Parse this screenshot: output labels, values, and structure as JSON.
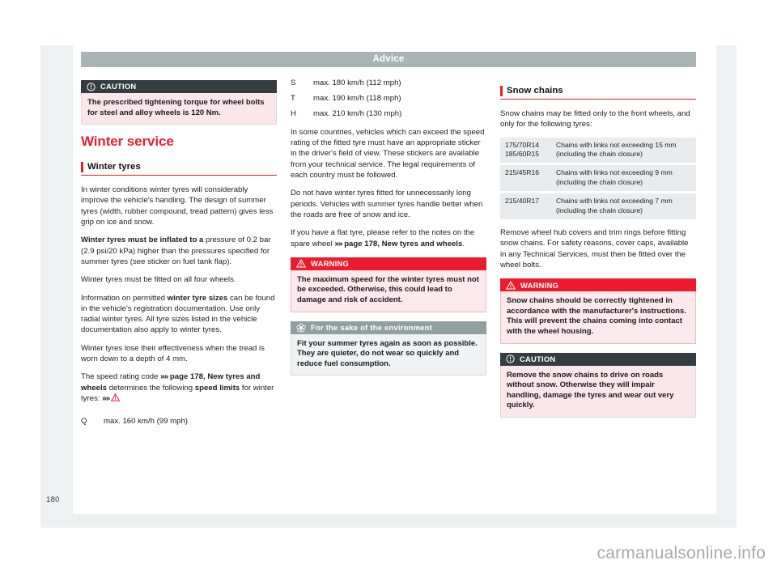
{
  "document": {
    "running_header": "Advice",
    "page_number": "180",
    "watermark": "carmanualsonline.info"
  },
  "colors": {
    "accent_red": "#ec1c2e",
    "warning_red": "#ed1b2e",
    "caution_dark": "#343d40",
    "env_gray": "#90a09e",
    "header_gray": "#a8b5b4",
    "table_row": "#e9ecee"
  },
  "column1": {
    "caution_box": {
      "icon": "exclamation-circle-icon",
      "title": "CAUTION",
      "text": "The prescribed tightening torque for wheel bolts for steel and alloy wheels is 120 Nm."
    },
    "section_title": "Winter service",
    "subsection_title": "Winter tyres",
    "paragraphs": [
      "In winter conditions winter tyres will considerably improve the vehicle's handling. The design of summer tyres (width, rubber compound, tread pattern) gives less grip on ice and snow.",
      "Winter tyres must be fitted on all four wheels.",
      "Winter tyres lose their effectiveness when the tread is worn down to a depth of 4 mm."
    ],
    "pressure_paragraph": {
      "bold_lead": "Winter tyres must be inflated to a",
      "rest": " pressure of 0.2 bar (2.9 psi/20 kPa) higher than the pressures specified for summer tyres (see sticker on fuel tank flap)."
    },
    "sizes_paragraph": {
      "part1": "Information on permitted ",
      "bold": "winter tyre sizes",
      "part2": " can be found in the vehicle's registration documentation. Use only radial winter tyres. All tyre sizes listed in the vehicle documentation also apply to winter tyres."
    },
    "speed_code_paragraph": {
      "part1": "The speed rating code ",
      "arrow": "»»",
      "ref": " page 178, New tyres and wheels",
      "part2": " determines the following ",
      "bold": "speed limits",
      "part3": " for winter tyres: ",
      "arrow2": "»»",
      "triangle_icon": "warning-triangle-icon"
    },
    "speed_rating_first": {
      "code": "Q",
      "value": "max. 160 km/h (99 mph)"
    }
  },
  "column2": {
    "speed_ratings": [
      {
        "code": "S",
        "value": "max. 180 km/h (112 mph)"
      },
      {
        "code": "T",
        "value": "max. 190 km/h (118 mph)"
      },
      {
        "code": "H",
        "value": "max. 210 km/h (130 mph)"
      }
    ],
    "paragraphs": [
      "In some countries, vehicles which can exceed the speed rating of the fitted tyre must have an appropriate sticker in the driver's field of view. These stickers are available from your technical service. The legal requirements of each country must be followed.",
      "Do not have winter tyres fitted for unnecessarily long periods. Vehicles with summer tyres handle better when the roads are free of snow and ice."
    ],
    "flat_tyre_paragraph": {
      "part1": "If you have a flat tyre, please refer to the notes on the spare wheel ",
      "arrow": "»»",
      "ref": " page 178, New tyres and wheels",
      "part2": "."
    },
    "warning_box": {
      "icon": "warning-triangle-icon",
      "title": "WARNING",
      "text": "The maximum speed for the winter tyres must not be exceeded. Otherwise, this could lead to damage and risk of accident."
    },
    "environment_box": {
      "icon": "environment-flower-icon",
      "title": "For the sake of the environment",
      "text": "Fit your summer tyres again as soon as possible. They are quieter, do not wear so quickly and reduce fuel consumption."
    }
  },
  "column3": {
    "subsection_title": "Snow chains",
    "intro": "Snow chains may be fitted only to the front wheels, and only for the following tyres:",
    "chain_table": [
      {
        "size": "175/70R14\n185/60R15",
        "desc": "Chains with links not exceeding 15 mm (including the chain closure)"
      },
      {
        "size": "215/45R16",
        "desc": "Chains with links not exceeding 9 mm (including the chain closure)"
      },
      {
        "size": "215/40R17",
        "desc": "Chains with links not exceeding 7 mm (including the chain closure)"
      }
    ],
    "after_table": "Remove wheel hub covers and trim rings before fitting snow chains. For safety reasons, cover caps, available in any Technical Services, must then be fitted over the wheel bolts.",
    "warning_box": {
      "icon": "warning-triangle-icon",
      "title": "WARNING",
      "text": "Snow chains should be correctly tightened in accordance with the manufacturer's instructions. This will prevent the chains coming into contact with the wheel housing."
    },
    "caution_box": {
      "icon": "exclamation-circle-icon",
      "title": "CAUTION",
      "text": "Remove the snow chains to drive on roads without snow. Otherwise they will impair handling, damage the tyres and wear out very quickly."
    }
  }
}
